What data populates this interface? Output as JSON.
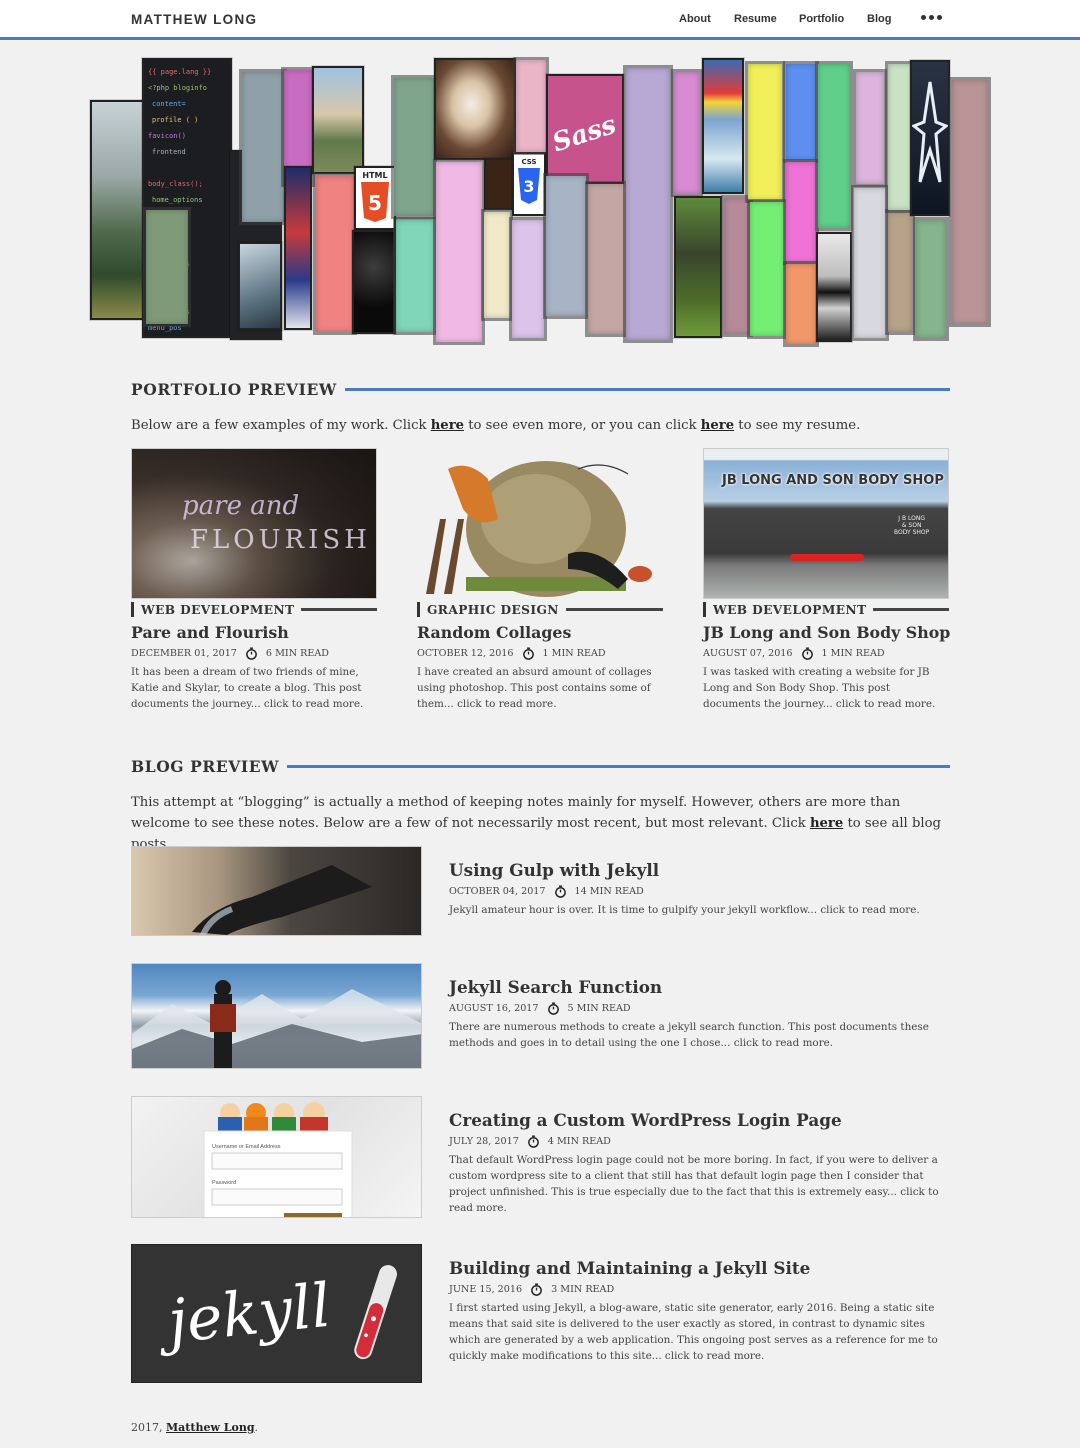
{
  "site": {
    "brand": "MATTHEW LONG"
  },
  "nav": {
    "items": [
      "About",
      "Resume",
      "Portfolio",
      "Blog"
    ],
    "more_icon": "more-dots-icon"
  },
  "colors": {
    "accent": "#4a7abf",
    "background": "#f1f1f1",
    "text": "#333333"
  },
  "hero": {
    "image_text": {
      "html": "HTML",
      "html_num": "5",
      "css": "CSS",
      "css_num": "3",
      "sass": "Sass"
    }
  },
  "portfolio": {
    "heading": "PORTFOLIO PREVIEW",
    "intro_before": "Below are a few examples of my work. Click ",
    "intro_link1": "here",
    "intro_mid": " to see even more, or you can click ",
    "intro_link2": "here",
    "intro_after": " to see my resume.",
    "cards": [
      {
        "category": "WEB DEVELOPMENT",
        "title": "Pare and Flourish",
        "date": "DECEMBER 01, 2017",
        "read": "6 MIN READ",
        "excerpt": "It has been a dream of two friends of mine, Katie and Skylar, to create a blog. This post documents the journey... click to read more.",
        "thumb_text": [
          "pare and",
          "FLOURISH"
        ]
      },
      {
        "category": "GRAPHIC DESIGN",
        "title": "Random Collages",
        "date": "OCTOBER 12, 2016",
        "read": "1 MIN READ",
        "excerpt": "I have created an absurd amount of collages using photoshop. This post contains some of them... click to read more."
      },
      {
        "category": "WEB DEVELOPMENT",
        "title": "JB Long and Son Body Shop",
        "date": "AUGUST 07, 2016",
        "read": "1 MIN READ",
        "excerpt": "I was tasked with creating a website for JB Long and Son Body Shop. This post documents the journey... click to read more.",
        "thumb_text": "JB LONG AND SON BODY SHOP",
        "thumb_sign": [
          "J B LONG",
          "& SON",
          "BODY SHOP"
        ]
      }
    ]
  },
  "blog": {
    "heading": "BLOG PREVIEW",
    "intro_before": "This attempt at “blogging” is actually a method of keeping notes mainly for myself. However, others are more than welcome to see these notes. Below are a few of not necessarily most recent, but most relevant. Click ",
    "intro_link": "here",
    "intro_after": " to see all blog posts.",
    "posts": [
      {
        "title": "Using Gulp with Jekyll",
        "date": "OCTOBER 04, 2017",
        "read": "14 MIN READ",
        "excerpt": "Jekyll amateur hour is over. It is time to gulpify your jekyll workflow... click to read more."
      },
      {
        "title": "Jekyll Search Function",
        "date": "AUGUST 16, 2017",
        "read": "5 MIN READ",
        "excerpt": "There are numerous methods to create a jekyll search function. This post documents these methods and goes in to detail using the one I chose... click to read more."
      },
      {
        "title": "Creating a Custom WordPress Login Page",
        "date": "JULY 28, 2017",
        "read": "4 MIN READ",
        "excerpt": "That default WordPress login page could not be more boring. In fact, if you were to deliver a custom wordpress site to a client that still has that default login page then I consider that project unfinished. This is true especially due to the fact that this is extremely easy... click to read more.",
        "thumb_labels": [
          "Username or Email Address",
          "Password"
        ]
      },
      {
        "title": "Building and Maintaining a Jekyll Site",
        "date": "JUNE 15, 2016",
        "read": "3 MIN READ",
        "excerpt": "I first started using Jekyll, a blog-aware, static site generator, early 2016. Being a static site means that said site is delivered to the user exactly as stored, in contrast to dynamic sites which are generated by a web application. This ongoing post serves as a reference for me to quickly make modifications to this site... click to read more.",
        "thumb_text": "jekyll"
      }
    ]
  },
  "footer": {
    "prefix": "2017, ",
    "link": "Matthew Long",
    "suffix": "."
  }
}
